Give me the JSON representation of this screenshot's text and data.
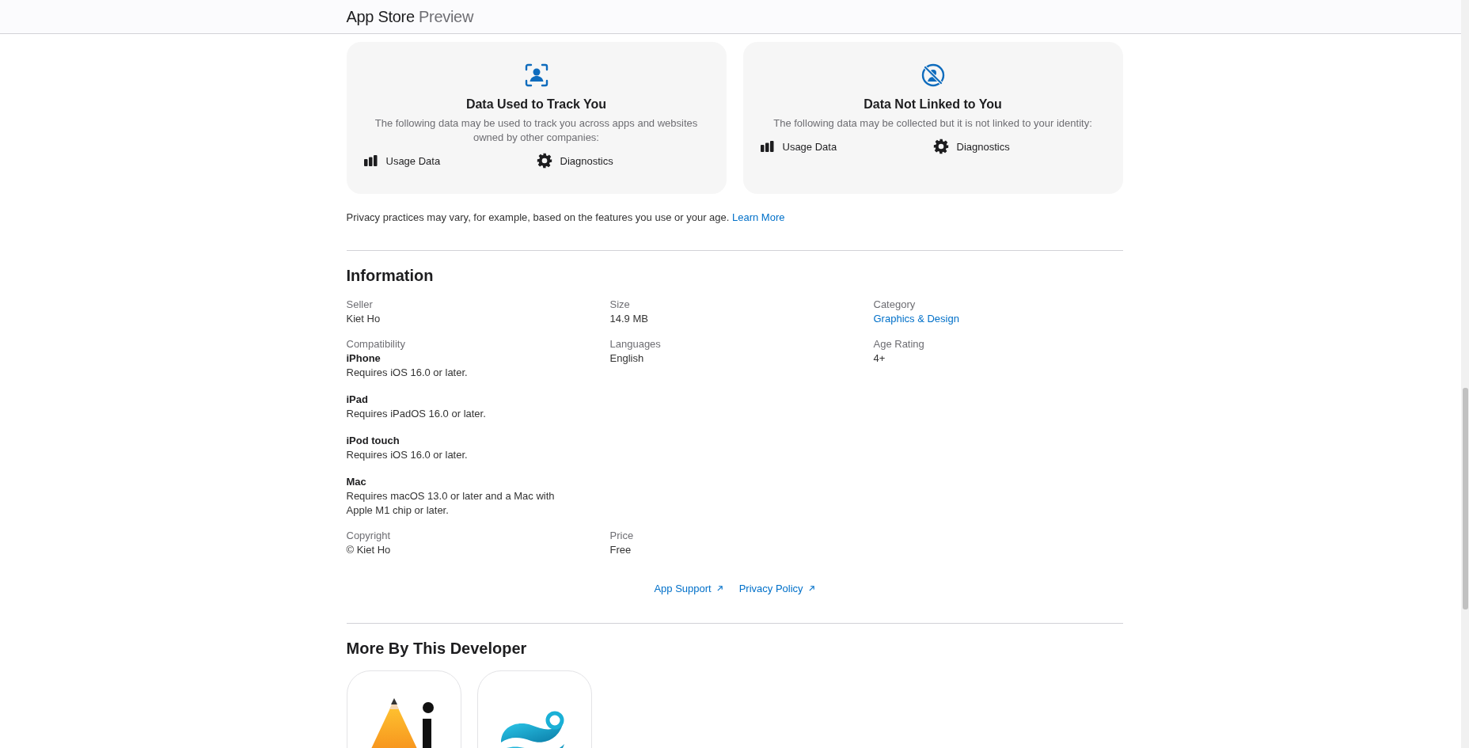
{
  "header": {
    "brand": "App Store",
    "suffix": "Preview"
  },
  "privacy_cards": [
    {
      "kind": "track",
      "title": "Data Used to Track You",
      "description": "The following data may be used to track you across apps and websites owned by other companies:",
      "items": [
        {
          "kind": "usage",
          "label": "Usage Data"
        },
        {
          "kind": "diagnostics",
          "label": "Diagnostics"
        }
      ]
    },
    {
      "kind": "not-linked",
      "title": "Data Not Linked to You",
      "description": "The following data may be collected but it is not linked to your identity:",
      "items": [
        {
          "kind": "usage",
          "label": "Usage Data"
        },
        {
          "kind": "diagnostics",
          "label": "Diagnostics"
        }
      ]
    }
  ],
  "privacy_note": {
    "text": "Privacy practices may vary, for example, based on the features you use or your age.",
    "link": "Learn More"
  },
  "information": {
    "heading": "Information",
    "rows": [
      [
        {
          "label": "Seller",
          "kind": "text",
          "value": "Kiet Ho"
        },
        {
          "label": "Size",
          "kind": "text",
          "value": "14.9 MB"
        },
        {
          "label": "Category",
          "kind": "link",
          "value": "Graphics & Design"
        }
      ],
      [
        {
          "label": "Compatibility",
          "kind": "devices",
          "devices": [
            {
              "name": "iPhone",
              "requirement": "Requires iOS 16.0 or later."
            },
            {
              "name": "iPad",
              "requirement": "Requires iPadOS 16.0 or later."
            },
            {
              "name": "iPod touch",
              "requirement": "Requires iOS 16.0 or later."
            },
            {
              "name": "Mac",
              "requirement": "Requires macOS 13.0 or later and a Mac with Apple M1 chip or later."
            }
          ]
        },
        {
          "label": "Languages",
          "kind": "text",
          "value": "English"
        },
        {
          "label": "Age Rating",
          "kind": "text",
          "value": "4+"
        }
      ],
      [
        {
          "label": "Copyright",
          "kind": "text",
          "value": "© Kiet Ho"
        },
        {
          "label": "Price",
          "kind": "text",
          "value": "Free"
        }
      ]
    ]
  },
  "links": [
    {
      "label": "App Support"
    },
    {
      "label": "Privacy Policy"
    }
  ],
  "more_by": {
    "heading": "More By This Developer",
    "apps": [
      {
        "kind": "pencil"
      },
      {
        "kind": "wave"
      }
    ]
  }
}
